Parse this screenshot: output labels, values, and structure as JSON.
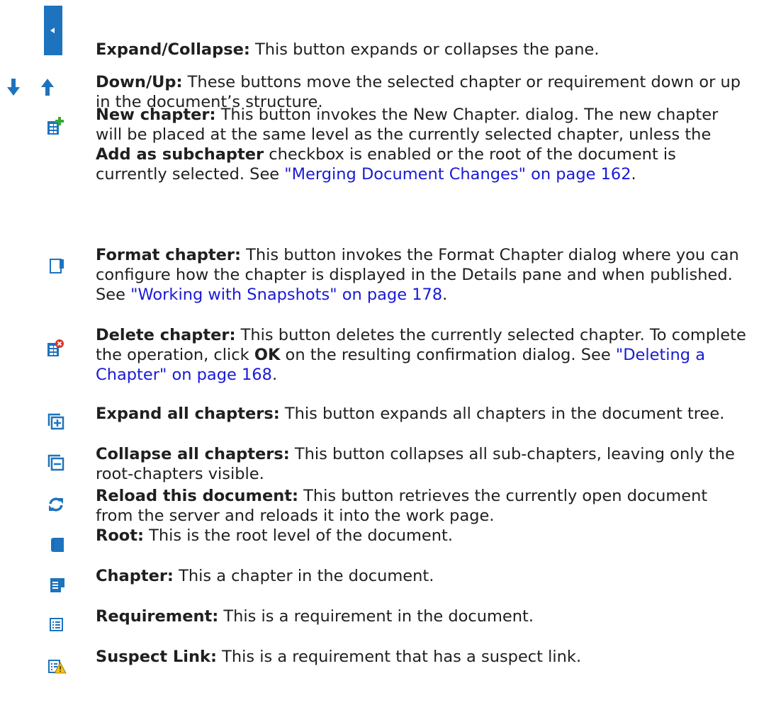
{
  "colors": {
    "icon_blue": "#1e73be",
    "link": "#1a1ad6",
    "plus_green": "#3aa63a",
    "delete_red": "#d9342b",
    "warn_yellow": "#f2c314"
  },
  "items": [
    {
      "icon": "expand-collapse-pane-icon",
      "term": "Expand/Collapse:",
      "text": " This button expands or collapses the pane."
    },
    {
      "icon": "down-up-arrows-icon",
      "term": "Down/Up:",
      "text": " These buttons move the selected chapter or requirement down or up in the document’s structure."
    },
    {
      "icon": "new-chapter-icon",
      "term": "New chapter:",
      "text1": " This button invokes the New Chapter. dialog. The new chapter will be placed at the same level as the currently selected chapter, unless the ",
      "bold2": "Add as subchapter",
      "text2": " checkbox is enabled or the root of the document is currently selected. See ",
      "link": "\"Merging Document Changes\" on page 162",
      "end": "."
    },
    {
      "icon": "format-chapter-icon",
      "term": "Format chapter:",
      "text1": " This button invokes the Format Chapter dialog where you can configure how the chapter is displayed in the Details pane and when published. See ",
      "link": "\"Working with Snapshots\" on page 178",
      "end": "."
    },
    {
      "icon": "delete-chapter-icon",
      "term": "Delete chapter:",
      "text1": " This button deletes the currently selected chapter. To complete the operation, click ",
      "bold2": "OK",
      "text2": " on the resulting confirmation dialog. See ",
      "link": "\"Deleting a Chapter\" on page 168",
      "end": "."
    },
    {
      "icon": "expand-all-icon",
      "term": "Expand all chapters:",
      "text": " This button expands all chapters in the document tree."
    },
    {
      "icon": "collapse-all-icon",
      "term": "Collapse all chapters:",
      "text": " This button collapses all sub-chapters, leaving only the root-chapters visible."
    },
    {
      "icon": "reload-icon",
      "term": "Reload this document:",
      "text": " This button retrieves the currently open document from the server and reloads it into the work page."
    },
    {
      "icon": "root-book-icon",
      "term": "Root:",
      "text": " This is the root level of the document."
    },
    {
      "icon": "chapter-icon",
      "term": "Chapter:",
      "text": " This a chapter in the document."
    },
    {
      "icon": "requirement-icon",
      "term": "Requirement:",
      "text": " This is a requirement in the document."
    },
    {
      "icon": "suspect-link-icon",
      "term": "Suspect Link:",
      "text": " This is a requirement that has a suspect link."
    }
  ]
}
